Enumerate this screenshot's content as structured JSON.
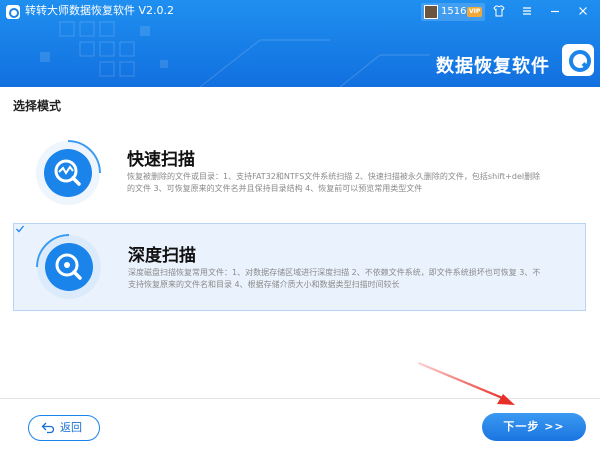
{
  "titlebar": {
    "app_title": "转转大师数据恢复软件 V2.0.2",
    "user_id": "15160...",
    "vip_label": "VIP",
    "icons": [
      "shirt-icon",
      "menu-icon",
      "minimize-icon",
      "close-icon"
    ]
  },
  "banner": {
    "brand_title": "数据恢复软件"
  },
  "section": {
    "title": "选择模式"
  },
  "modes": [
    {
      "name": "快速扫描",
      "icon": "quick-scan-icon",
      "selected": false,
      "desc": "恢复被删除的文件或目录：1、支持FAT32和NTFS文件系统扫描 2、快速扫描被永久删除的文件，包括shift+del删除的文件 3、可恢复原来的文件名并且保持目录结构 4、恢复前可以预览常用类型文件"
    },
    {
      "name": "深度扫描",
      "icon": "deep-scan-icon",
      "selected": true,
      "desc": "深度磁盘扫描恢复常用文件：1、对数据存储区域进行深度扫描 2、不依赖文件系统，即文件系统损坏也可恢复 3、不支持恢复原来的文件名和目录 4、根据存储介质大小和数据类型扫描时间较长"
    }
  ],
  "footer": {
    "back_label": "返回",
    "next_label": "下一步 >>"
  },
  "colors": {
    "accent": "#1a84ea",
    "header_top": "#1f8ff0",
    "header_bottom": "#1270df",
    "selected_bg": "#eaf3fd",
    "annotation": "#e8302a"
  }
}
